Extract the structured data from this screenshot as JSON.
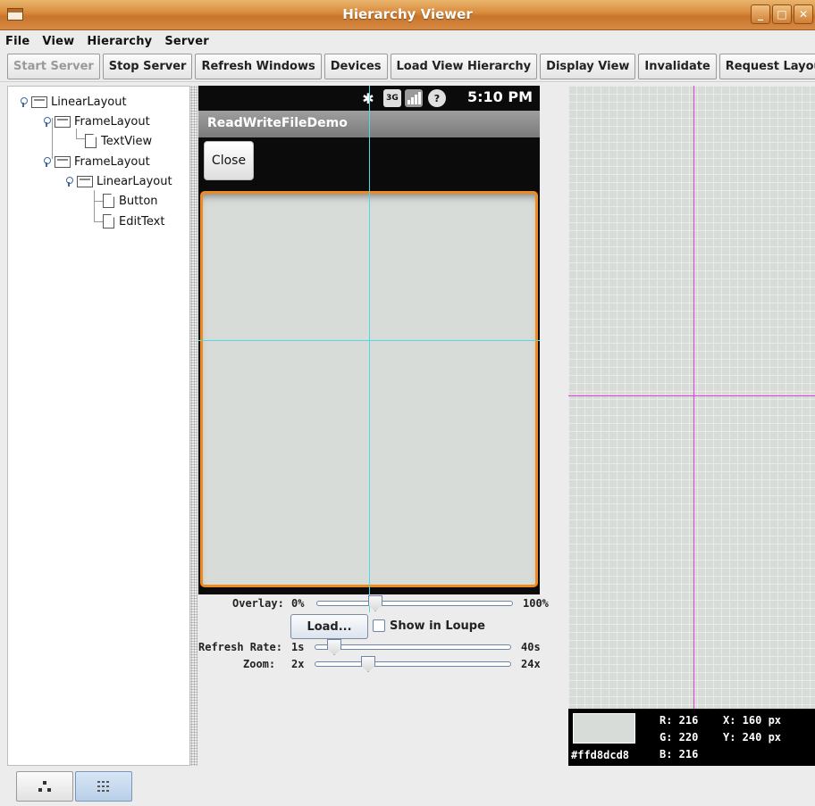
{
  "window": {
    "title": "Hierarchy Viewer",
    "controls": [
      "_",
      "□",
      "✕"
    ]
  },
  "menu": [
    "File",
    "View",
    "Hierarchy",
    "Server"
  ],
  "toolbar": {
    "start_server": "Start Server",
    "stop_server": "Stop Server",
    "refresh_windows": "Refresh Windows",
    "devices": "Devices",
    "load_view_hierarchy": "Load View Hierarchy",
    "display_view": "Display View",
    "invalidate": "Invalidate",
    "request_layout": "Request Layout"
  },
  "tree": {
    "nodes": [
      "LinearLayout",
      "FrameLayout",
      "TextView",
      "FrameLayout",
      "LinearLayout",
      "Button",
      "EditText"
    ]
  },
  "device": {
    "status_time": "5:10 PM",
    "status_icons": [
      "bluetooth-icon",
      "3g-icon",
      "signal-icon",
      "alert-icon"
    ],
    "app_title": "ReadWriteFileDemo",
    "close_label": "Close",
    "edittext_border_color": "#f08a1c",
    "crosshair_color": "#4dd9e8"
  },
  "controls": {
    "overlay_label": "Overlay:",
    "overlay_min": "0%",
    "overlay_max": "100%",
    "load_label": "Load...",
    "show_in_loupe": "Show in Loupe",
    "refresh_label": "Refresh Rate:",
    "refresh_min": "1s",
    "refresh_max": "40s",
    "zoom_label": "Zoom:",
    "zoom_min": "2x",
    "zoom_max": "24x"
  },
  "pixel": {
    "hex": "#ffd8dcd8",
    "r": "R: 216",
    "g": "G: 220",
    "b": "B: 216",
    "x": "X: 160 px",
    "y": "Y: 240 px",
    "swatch_color": "#d8dcd8",
    "crosshair_color": "#e040e0"
  }
}
